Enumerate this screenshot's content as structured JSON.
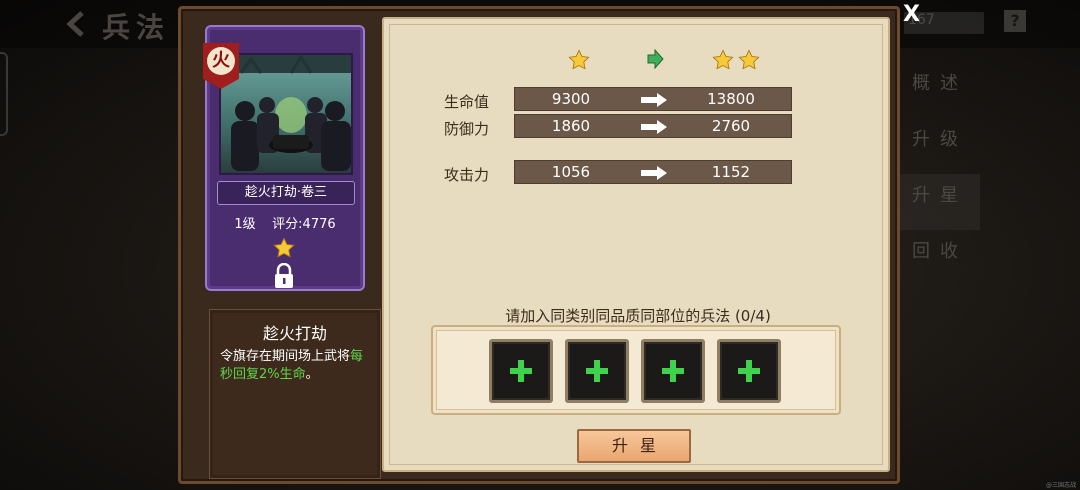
{
  "topbar": {
    "title": "兵法",
    "counter": "167",
    "help": "?",
    "close": "X"
  },
  "side_tabs": [
    {
      "label": "概述",
      "active": false
    },
    {
      "label": "升级",
      "active": false
    },
    {
      "label": "升星",
      "active": true
    },
    {
      "label": "回收",
      "active": false
    }
  ],
  "card": {
    "element_badge": "火",
    "name": "趁火打劫·卷三",
    "level": "1级",
    "score_label": "评分:",
    "score": "4776",
    "stars": 1,
    "locked": true
  },
  "description": {
    "title": "趁火打劫",
    "text_plain": "令旗存在期间场上武将",
    "text_highlight_1": "每",
    "text_highlight_2": "秒回复2%生命",
    "text_end": "。"
  },
  "star_upgrade": {
    "current_stars": 1,
    "next_stars": 2,
    "stats": [
      {
        "label": "生命值",
        "current": "9300",
        "next": "13800"
      },
      {
        "label": "防御力",
        "current": "1860",
        "next": "2760"
      },
      {
        "label": "攻击力",
        "current": "1056",
        "next": "1152"
      }
    ],
    "requirement": "请加入同类别同品质同部位的兵法 (0/4)",
    "slots": 4,
    "button_label": "升星"
  },
  "colors": {
    "highlight_green": "#5ed64a",
    "card_purple": "#4a2d6e",
    "parchment": "#e8dcc0",
    "button": "#f2b887"
  },
  "watermark": "@三国志战棋"
}
